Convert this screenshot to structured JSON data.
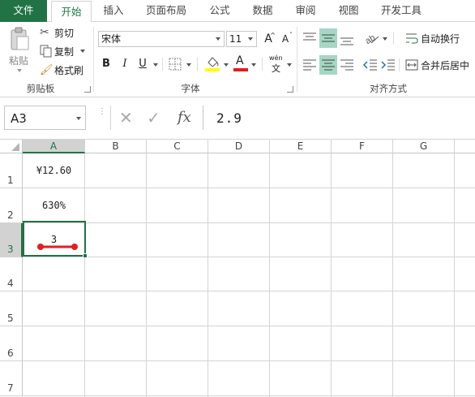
{
  "tabs": [
    {
      "label": "文件",
      "active": false,
      "file": true
    },
    {
      "label": "开始",
      "active": true,
      "file": false
    },
    {
      "label": "插入",
      "active": false,
      "file": false
    },
    {
      "label": "页面布局",
      "active": false,
      "file": false
    },
    {
      "label": "公式",
      "active": false,
      "file": false
    },
    {
      "label": "数据",
      "active": false,
      "file": false
    },
    {
      "label": "审阅",
      "active": false,
      "file": false
    },
    {
      "label": "视图",
      "active": false,
      "file": false
    },
    {
      "label": "开发工具",
      "active": false,
      "file": false
    }
  ],
  "clipboard": {
    "paste_label": "粘贴",
    "cut_label": "剪切",
    "copy_label": "复制",
    "format_painter_label": "格式刷",
    "group_label": "剪贴板"
  },
  "font": {
    "font_name": "宋体",
    "font_size": "11",
    "grow_label": "A",
    "shrink_label": "A",
    "bold_label": "B",
    "italic_label": "I",
    "underline_label": "U",
    "font_color_label": "A",
    "phonetic_top": "wén",
    "phonetic_bottom": "文",
    "group_label": "字体"
  },
  "alignment": {
    "wrap_text_label": "自动换行",
    "merge_center_label": "合并后居中",
    "group_label": "对齐方式"
  },
  "formula_bar": {
    "name_box": "A3",
    "cancel_symbol": "✕",
    "enter_symbol": "✓",
    "fx_label": "fx",
    "formula_value": "2.9"
  },
  "columns": [
    "A",
    "B",
    "C",
    "D",
    "E",
    "F",
    "G"
  ],
  "rows": [
    "1",
    "2",
    "3",
    "4",
    "5",
    "6",
    "7"
  ],
  "cells": {
    "A1": "¥12.60",
    "A2": "630%",
    "A3": "3"
  },
  "selected_cell": "A3",
  "colors": {
    "accent": "#217346",
    "highlight": "#a5d7c4",
    "annotation": "#e02020",
    "font_color_bar": "#e31c1c",
    "fill_color_bar": "#ffff00"
  }
}
